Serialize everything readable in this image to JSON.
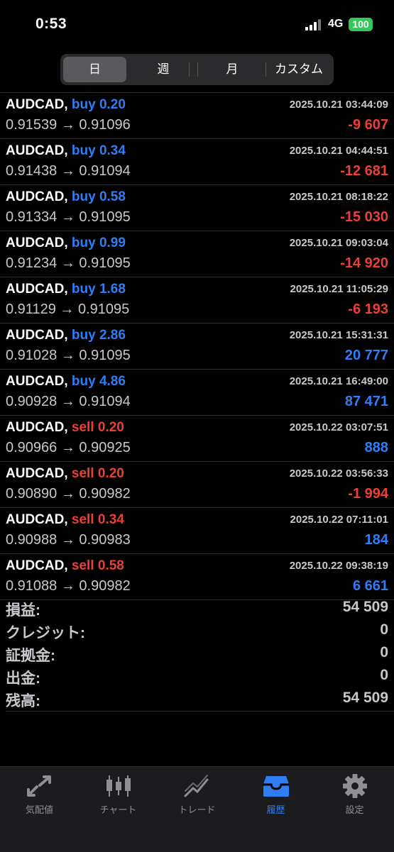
{
  "status": {
    "time": "0:53",
    "network": "4G",
    "battery": "100"
  },
  "segments": [
    {
      "label": "日"
    },
    {
      "label": "週"
    },
    {
      "label": "月"
    },
    {
      "label": "カスタム"
    }
  ],
  "active_segment": "日",
  "deals": [
    {
      "symbol": "AUDCAD,",
      "type": "buy",
      "volume": "0.20",
      "time": "2025.10.21 03:44:09",
      "open_price": "0.91539",
      "close_price": "0.91096",
      "profit": "-9 607"
    },
    {
      "symbol": "AUDCAD,",
      "type": "buy",
      "volume": "0.34",
      "time": "2025.10.21 04:44:51",
      "open_price": "0.91438",
      "close_price": "0.91094",
      "profit": "-12 681"
    },
    {
      "symbol": "AUDCAD,",
      "type": "buy",
      "volume": "0.58",
      "time": "2025.10.21 08:18:22",
      "open_price": "0.91334",
      "close_price": "0.91095",
      "profit": "-15 030"
    },
    {
      "symbol": "AUDCAD,",
      "type": "buy",
      "volume": "0.99",
      "time": "2025.10.21 09:03:04",
      "open_price": "0.91234",
      "close_price": "0.91095",
      "profit": "-14 920"
    },
    {
      "symbol": "AUDCAD,",
      "type": "buy",
      "volume": "1.68",
      "time": "2025.10.21 11:05:29",
      "open_price": "0.91129",
      "close_price": "0.91095",
      "profit": "-6 193"
    },
    {
      "symbol": "AUDCAD,",
      "type": "buy",
      "volume": "2.86",
      "time": "2025.10.21 15:31:31",
      "open_price": "0.91028",
      "close_price": "0.91095",
      "profit": "20 777"
    },
    {
      "symbol": "AUDCAD,",
      "type": "buy",
      "volume": "4.86",
      "time": "2025.10.21 16:49:00",
      "open_price": "0.90928",
      "close_price": "0.91094",
      "profit": "87 471"
    },
    {
      "symbol": "AUDCAD,",
      "type": "sell",
      "volume": "0.20",
      "time": "2025.10.22 03:07:51",
      "open_price": "0.90966",
      "close_price": "0.90925",
      "profit": "888"
    },
    {
      "symbol": "AUDCAD,",
      "type": "sell",
      "volume": "0.20",
      "time": "2025.10.22 03:56:33",
      "open_price": "0.90890",
      "close_price": "0.90982",
      "profit": "-1 994"
    },
    {
      "symbol": "AUDCAD,",
      "type": "sell",
      "volume": "0.34",
      "time": "2025.10.22 07:11:01",
      "open_price": "0.90988",
      "close_price": "0.90983",
      "profit": "184"
    },
    {
      "symbol": "AUDCAD,",
      "type": "sell",
      "volume": "0.58",
      "time": "2025.10.22 09:38:19",
      "open_price": "0.91088",
      "close_price": "0.90982",
      "profit": "6 661"
    }
  ],
  "arrow": "→",
  "summary": [
    {
      "label": "損益:",
      "value": "54 509"
    },
    {
      "label": "クレジット:",
      "value": "0"
    },
    {
      "label": "証拠金:",
      "value": "0"
    },
    {
      "label": "出金:",
      "value": "0"
    },
    {
      "label": "残高:",
      "value": "54 509"
    }
  ],
  "tabs": [
    {
      "label": "気配値",
      "icon": "quotes-arrows-icon"
    },
    {
      "label": "チャート",
      "icon": "candlestick-chart-icon"
    },
    {
      "label": "トレード",
      "icon": "trade-trend-icon"
    },
    {
      "label": "履歴",
      "icon": "history-inbox-icon"
    },
    {
      "label": "設定",
      "icon": "gear-icon"
    }
  ],
  "active_tab": "履歴",
  "colors": {
    "buy": "#2f7ef5",
    "sell": "#eb4034",
    "profit_positive": "#2f7ef5",
    "profit_negative": "#eb4034",
    "active_tab": "#2f7ef5",
    "battery": "#34c759"
  }
}
